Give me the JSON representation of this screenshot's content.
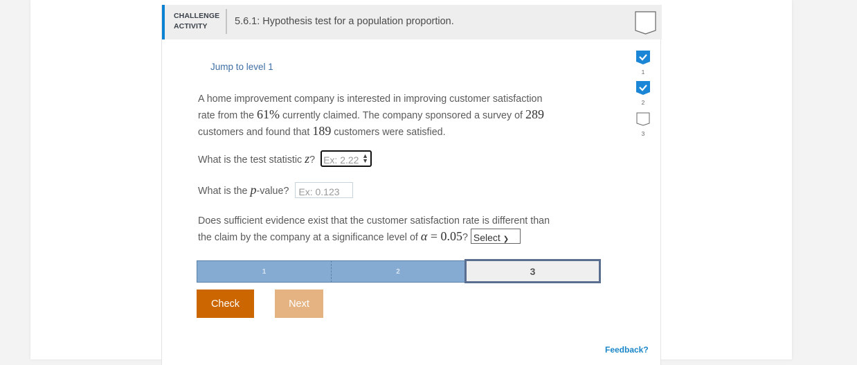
{
  "header": {
    "label_line1": "CHALLENGE",
    "label_line2": "ACTIVITY",
    "title": "5.6.1: Hypothesis test for a population proportion."
  },
  "jump_link": "Jump to level 1",
  "problem": {
    "part1": "A home improvement company is interested in improving customer satisfaction",
    "part2a": "rate from the ",
    "claim": "61%",
    "part2b": " currently claimed. The company sponsored a survey of ",
    "n": "289",
    "part3a": "customers and found that ",
    "x": "189",
    "part3b": " customers were satisfied."
  },
  "questions": {
    "q1_text": "What is the test statistic ",
    "q1_var": "z",
    "q1_suffix": "?",
    "q1_placeholder": "Ex: 2.22",
    "q2_prefix": "What is the ",
    "q2_var": "p",
    "q2_suffix": "-value?",
    "q2_placeholder": "Ex: 0.123",
    "q3_line1": "Does sufficient evidence exist that the customer satisfaction rate is different than",
    "q3_line2": "the claim by the company at a significance level of ",
    "q3_alpha": "α",
    "q3_eq": " = ",
    "q3_value": "0.05",
    "q3_suffix": "?",
    "q3_select_value": "Select"
  },
  "progress": {
    "levels": [
      "1",
      "2",
      "3"
    ],
    "completed": 2,
    "current": 3
  },
  "buttons": {
    "check": "Check",
    "next": "Next"
  },
  "level_badges": [
    {
      "num": "1",
      "status": "complete"
    },
    {
      "num": "2",
      "status": "complete"
    },
    {
      "num": "3",
      "status": "incomplete"
    }
  ],
  "feedback": "Feedback?",
  "colors": {
    "accent": "#0b83d2",
    "check_button": "#cc6600",
    "next_button": "#e5b382",
    "progress_done": "#86abd2",
    "link": "#3f6fa5"
  }
}
